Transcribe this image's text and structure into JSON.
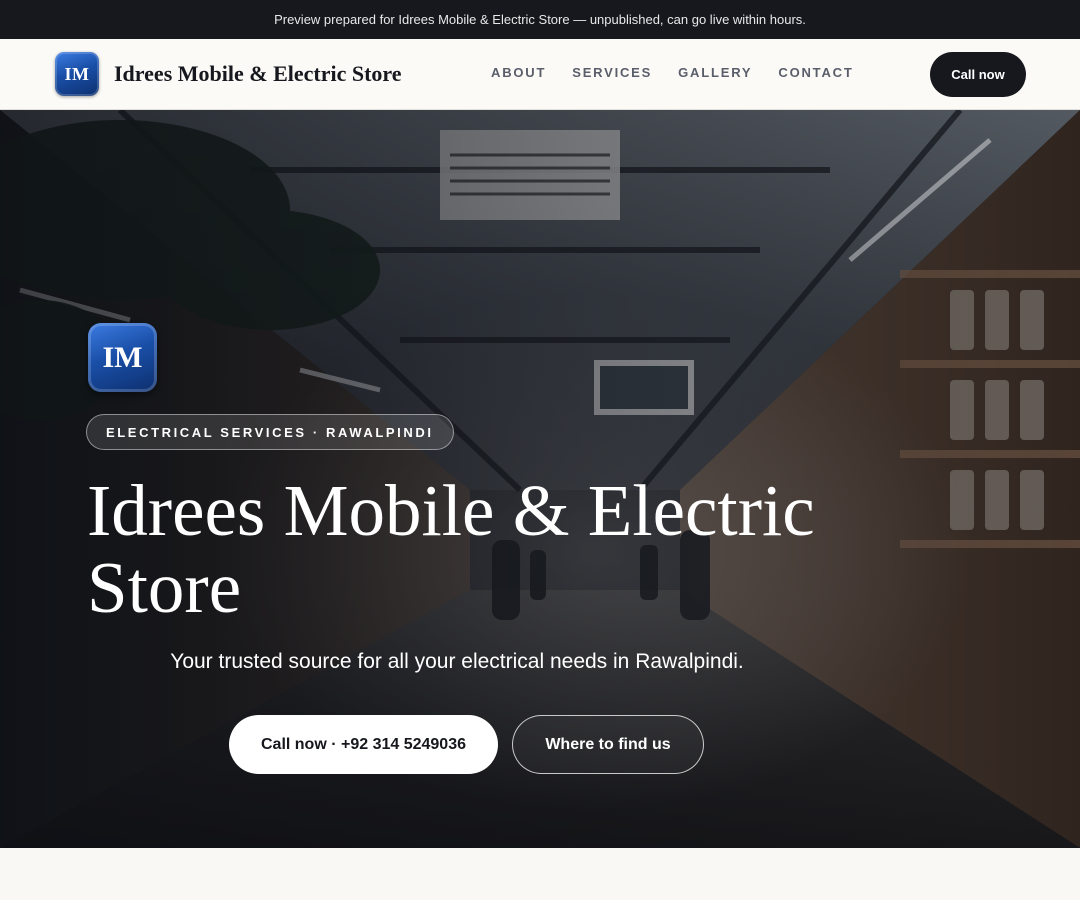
{
  "topbar": {
    "text": "Preview prepared for Idrees Mobile & Electric Store — unpublished, can go live within hours."
  },
  "header": {
    "logo_initials": "IM",
    "brand_name": "Idrees Mobile & Electric Store",
    "nav": [
      {
        "label": "ABOUT"
      },
      {
        "label": "SERVICES"
      },
      {
        "label": "GALLERY"
      },
      {
        "label": "CONTACT"
      }
    ],
    "cta_label": "Call now"
  },
  "hero": {
    "logo_initials": "IM",
    "eyebrow": "ELECTRICAL SERVICES · RAWALPINDI",
    "title": "Idrees Mobile & Electric Store",
    "subtitle": "Your trusted source for all your electrical needs in Rawalpindi.",
    "primary_button": "Call now · +92 314 5249036",
    "secondary_button": "Where to find us",
    "background_image": "market-alley-photo"
  },
  "colors": {
    "dark": "#16181d",
    "page_bg": "#f9f8f5",
    "logo_blue": "#1a4fa8"
  }
}
